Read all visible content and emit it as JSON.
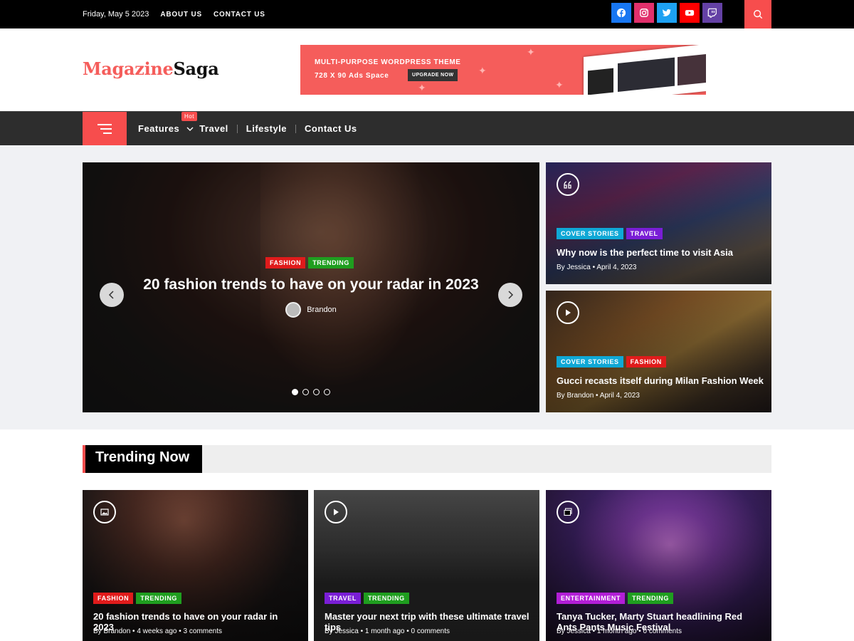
{
  "topbar": {
    "date": "Friday, May 5 2023",
    "links": [
      "ABOUT US",
      "CONTACT US"
    ],
    "social": [
      {
        "name": "facebook-icon",
        "color": "#1877f2"
      },
      {
        "name": "instagram-icon",
        "color": "#e1306c"
      },
      {
        "name": "twitter-icon",
        "color": "#1da1f2"
      },
      {
        "name": "youtube-icon",
        "color": "#ff0000"
      },
      {
        "name": "twitch-icon",
        "color": "#6441a5"
      }
    ]
  },
  "header": {
    "logo_part1": "Magazine",
    "logo_part2": "Saga",
    "ad": {
      "title": "MULTI-PURPOSE WORDPRESS THEME",
      "size": "728 X 90 Ads Space",
      "button": "UPGRADE NOW"
    }
  },
  "nav": {
    "items": [
      "Features",
      "Travel",
      "Lifestyle",
      "Contact Us"
    ],
    "hot_badge": "Hot"
  },
  "slider": {
    "categories": [
      "FASHION",
      "TRENDING"
    ],
    "title": "20 fashion trends to have on your radar in 2023",
    "author": "Brandon",
    "slide_count": 4,
    "active_slide": 1
  },
  "side_posts": [
    {
      "categories": [
        "COVER STORIES",
        "TRAVEL"
      ],
      "title": "Why now is the perfect time to visit Asia",
      "by": "By",
      "author": "Jessica",
      "date": "April 4, 2023",
      "format_icon": "quote-icon"
    },
    {
      "categories": [
        "COVER STORIES",
        "FASHION"
      ],
      "title": "Gucci recasts itself during Milan Fashion Week",
      "by": "By",
      "author": "Brandon",
      "date": "April 4, 2023",
      "format_icon": "play-icon"
    }
  ],
  "trending": {
    "heading": "Trending Now",
    "cards": [
      {
        "categories": [
          "FASHION",
          "TRENDING"
        ],
        "title": "20 fashion trends to have on your radar in 2023",
        "by": "By",
        "author": "Brandon",
        "time": "4 weeks ago",
        "comments": "3 comments",
        "format_icon": "image-icon"
      },
      {
        "categories": [
          "TRAVEL",
          "TRENDING"
        ],
        "title": "Master your next trip with these ultimate travel tips",
        "by": "By",
        "author": "Jessica",
        "time": "1 month ago",
        "comments": "0 comments",
        "format_icon": "play-icon"
      },
      {
        "categories": [
          "ENTERTAINMENT",
          "TRENDING"
        ],
        "title": "Tanya Tucker, Marty Stuart headlining Red Ants Pants Music Festival",
        "by": "By",
        "author": "Jessica",
        "time": "1 month ago",
        "comments": "0 comments",
        "format_icon": "gallery-icon"
      }
    ]
  },
  "colors": {
    "accent": "#f74d4d",
    "fashion": "#e01b1b",
    "trending": "#1f9e1f",
    "cover_stories": "#0fa8d6",
    "travel": "#7a1ed6",
    "entertainment": "#b21ed6"
  }
}
